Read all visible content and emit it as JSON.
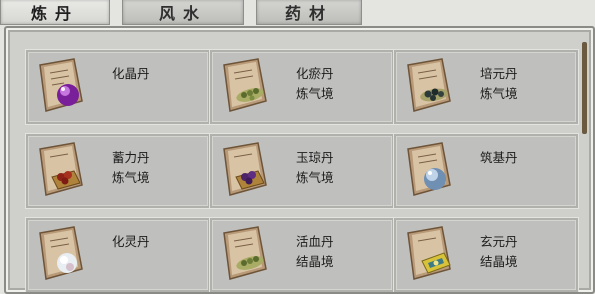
{
  "tabs": [
    {
      "label": "炼丹",
      "active": true
    },
    {
      "label": "风水",
      "active": false
    },
    {
      "label": "药材",
      "active": false
    }
  ],
  "items": [
    {
      "name": "化晶丹",
      "realm": "",
      "icon": "purple-orb-icon"
    },
    {
      "name": "化瘀丹",
      "realm": "炼气境",
      "icon": "green-herb-icon"
    },
    {
      "name": "培元丹",
      "realm": "炼气境",
      "icon": "dark-berries-icon"
    },
    {
      "name": "蓄力丹",
      "realm": "炼气境",
      "icon": "red-fruit-box-icon"
    },
    {
      "name": "玉琼丹",
      "realm": "炼气境",
      "icon": "purple-fruit-box-icon"
    },
    {
      "name": "筑基丹",
      "realm": "",
      "icon": "blue-orb-icon"
    },
    {
      "name": "化灵丹",
      "realm": "",
      "icon": "white-orb-icon"
    },
    {
      "name": "活血丹",
      "realm": "结晶境",
      "icon": "green-herb-icon"
    },
    {
      "name": "玄元丹",
      "realm": "结晶境",
      "icon": "gold-talisman-icon"
    }
  ],
  "colors": {
    "scroll_thumb": "#6b5a40",
    "card_bg": "#bfbfbd"
  }
}
